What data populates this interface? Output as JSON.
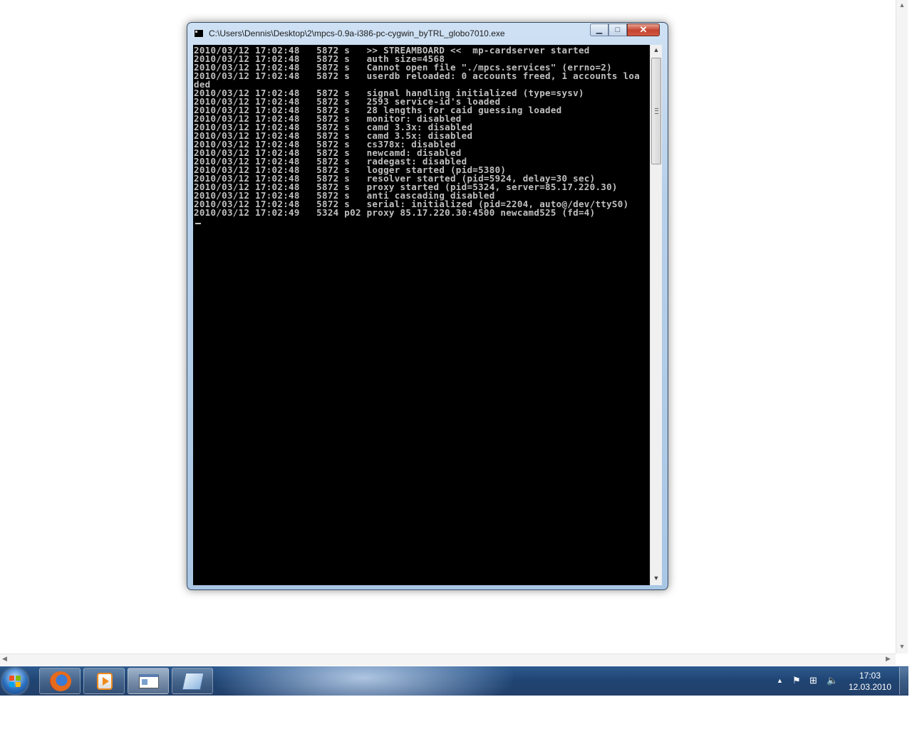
{
  "window": {
    "title": "C:\\Users\\Dennis\\Desktop\\2\\mpcs-0.9a-i386-pc-cygwin_byTRL_globo7010.exe",
    "minimize_label": "▁",
    "maximize_label": "□",
    "close_label": "✕"
  },
  "console": {
    "lines": [
      "2010/03/12 17:02:48   5872 s   >> STREAMBOARD <<  mp-cardserver started",
      "2010/03/12 17:02:48   5872 s   auth size=4568",
      "2010/03/12 17:02:48   5872 s   Cannot open file \"./mpcs.services\" (errno=2)",
      "2010/03/12 17:02:48   5872 s   userdb reloaded: 0 accounts freed, 1 accounts loa",
      "ded",
      "2010/03/12 17:02:48   5872 s   signal handling initialized (type=sysv)",
      "2010/03/12 17:02:48   5872 s   2593 service-id's loaded",
      "2010/03/12 17:02:48   5872 s   28 lengths for caid guessing loaded",
      "2010/03/12 17:02:48   5872 s   monitor: disabled",
      "2010/03/12 17:02:48   5872 s   camd 3.3x: disabled",
      "2010/03/12 17:02:48   5872 s   camd 3.5x: disabled",
      "2010/03/12 17:02:48   5872 s   cs378x: disabled",
      "2010/03/12 17:02:48   5872 s   newcamd: disabled",
      "2010/03/12 17:02:48   5872 s   radegast: disabled",
      "2010/03/12 17:02:48   5872 s   logger started (pid=5380)",
      "2010/03/12 17:02:48   5872 s   resolver started (pid=5924, delay=30 sec)",
      "2010/03/12 17:02:48   5872 s   proxy started (pid=5324, server=85.17.220.30)",
      "2010/03/12 17:02:48   5872 s   anti cascading disabled",
      "2010/03/12 17:02:48   5872 s   serial: initialized (pid=2204, auto@/dev/ttyS0)",
      "2010/03/12 17:02:49   5324 p02 proxy 85.17.220.30:4500 newcamd525 (fd=4)"
    ],
    "scroll_up": "▲",
    "scroll_down": "▼"
  },
  "page_scroll": {
    "up": "▲",
    "down": "▼",
    "left": "◀",
    "right": "▶"
  },
  "taskbar": {
    "buttons": [
      {
        "name": "firefox",
        "icon": "firefox-icon"
      },
      {
        "name": "media-player",
        "icon": "media-player-icon"
      },
      {
        "name": "console",
        "icon": "console-window-icon",
        "active": true
      },
      {
        "name": "editor",
        "icon": "editor-icon"
      }
    ],
    "tray": {
      "show_hidden": "▲",
      "action_center": "⚑",
      "network": "⊞",
      "volume": "🔈"
    },
    "clock": {
      "time": "17:03",
      "date": "12.03.2010"
    }
  }
}
